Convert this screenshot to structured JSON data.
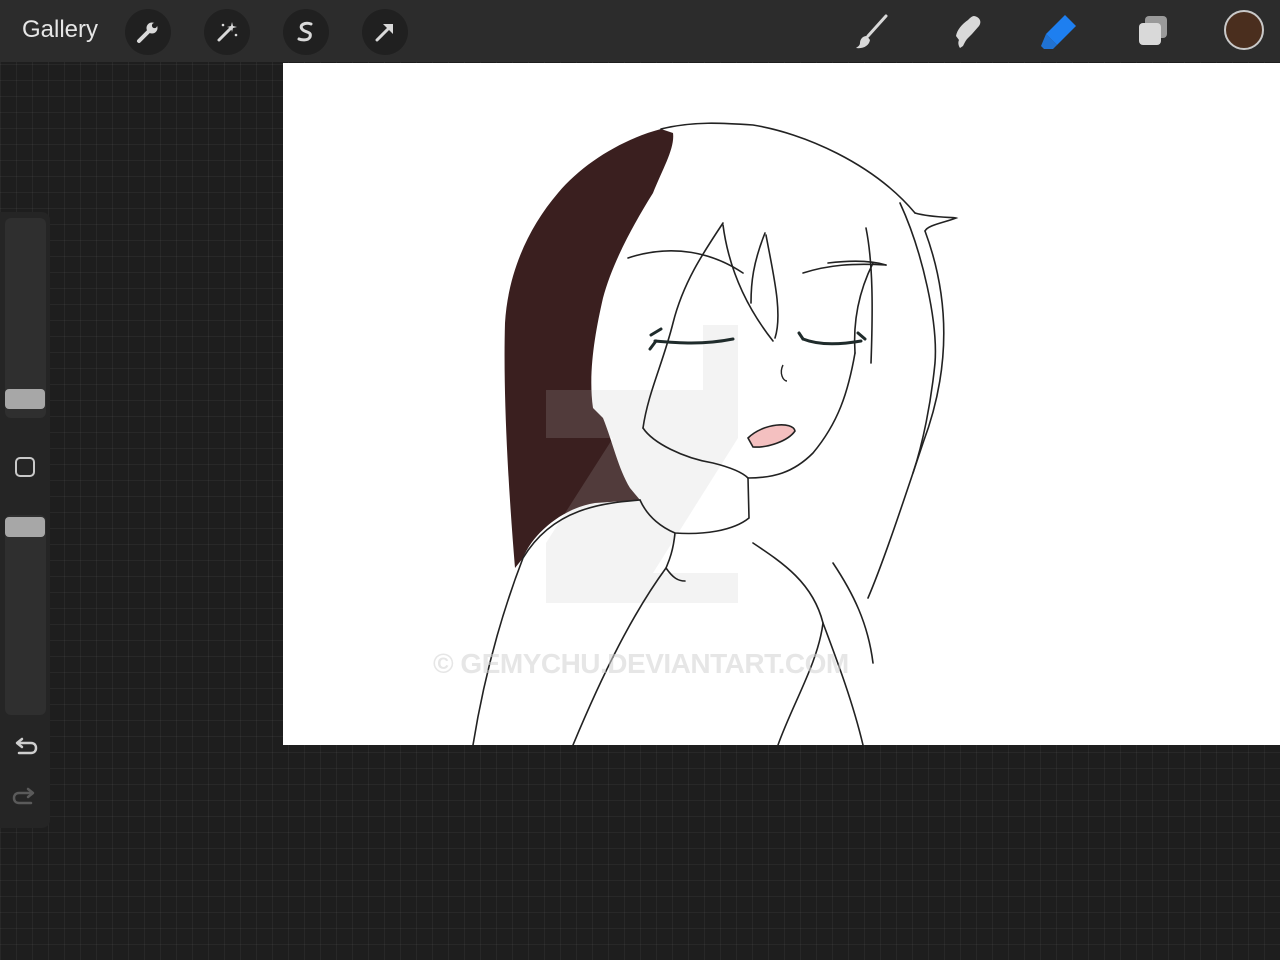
{
  "topbar": {
    "gallery_label": "Gallery",
    "left_tools": [
      "wrench-icon",
      "magic-wand-icon",
      "selection-icon",
      "transform-arrow-icon"
    ],
    "right_tools": [
      "brush-icon",
      "smudge-icon",
      "eraser-icon",
      "layers-icon"
    ],
    "active_tool": "eraser",
    "current_color": "#4a2e1e",
    "accent_color": "#1e7ff0"
  },
  "sidebar": {
    "controls": [
      "brush-size-slider",
      "modify-button",
      "brush-opacity-slider",
      "undo-icon",
      "redo-icon"
    ]
  },
  "canvas": {
    "background": "#ffffff",
    "hair_fill_color": "#3a1f1f",
    "watermark": "© GEMYCHU.DEVIANTART.COM"
  }
}
